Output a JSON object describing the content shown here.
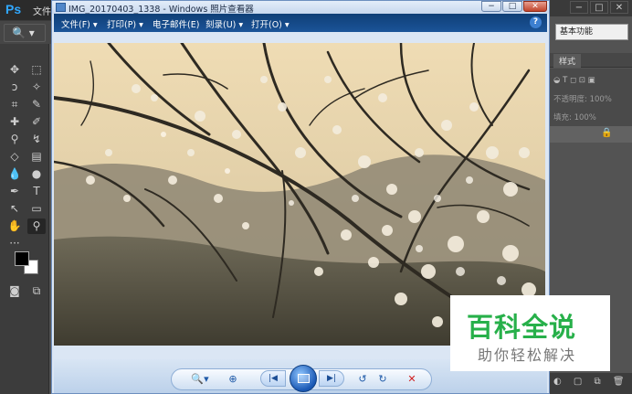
{
  "photoshop": {
    "logo": "Ps",
    "menu_file": "文件",
    "zoom_tool_icon": "🔍",
    "workspace_label": "基本功能",
    "panel_tab": "样式",
    "opacity_label": "不透明度: 100%",
    "fill_label": "填充: 100%",
    "window_controls": [
      "−",
      "□",
      "✕"
    ]
  },
  "viewer": {
    "title": "IMG_20170403_1338 - Windows 照片查看器",
    "window_buttons": [
      "−",
      "□",
      "✕"
    ],
    "menus": [
      {
        "label": "文件(F) ▾"
      },
      {
        "label": "打印(P) ▾"
      },
      {
        "label": "电子邮件(E)"
      },
      {
        "label": "刻录(U) ▾"
      },
      {
        "label": "打开(O) ▾"
      }
    ],
    "help": "?",
    "controls": {
      "zoom": "🔍▾",
      "fit": "⊕",
      "prev": "|◀",
      "next": "▶|",
      "rotate_ccw": "↺",
      "rotate_cw": "↻",
      "delete": "✕"
    }
  },
  "watermark": {
    "main": "百科全说",
    "sub": "助你轻松解决"
  }
}
